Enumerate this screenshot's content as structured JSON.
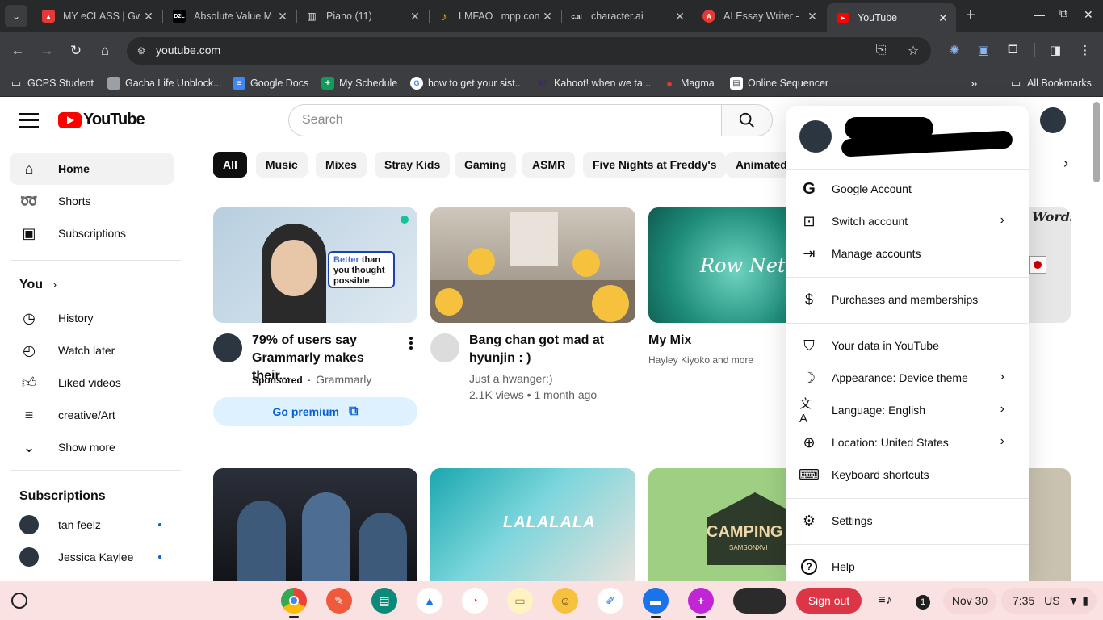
{
  "browser": {
    "tabs": [
      {
        "title": "MY eCLASS | Gwi",
        "icon": "eclass-icon",
        "color": "#e53935"
      },
      {
        "title": "Absolute Value M",
        "icon": "d2l-icon",
        "color": "#000000"
      },
      {
        "title": "Piano (11)",
        "icon": "piano-icon",
        "color": "#ffffff"
      },
      {
        "title": "LMFAO | mpp.con",
        "icon": "music-note-icon",
        "color": "#f4b400"
      },
      {
        "title": "character.ai",
        "icon": "character-ai-icon",
        "color": "#ffffff"
      },
      {
        "title": "AI Essay Writer -",
        "icon": "essay-writer-icon",
        "color": "#e53935"
      },
      {
        "title": "YouTube",
        "icon": "youtube-icon",
        "color": "#ff0000",
        "active": true
      }
    ],
    "url": "youtube.com",
    "bookmarks": [
      {
        "label": "GCPS Student",
        "icon": "folder-icon"
      },
      {
        "label": "Gacha Life Unblock...",
        "icon": "gacha-icon"
      },
      {
        "label": "Google Docs",
        "icon": "docs-icon"
      },
      {
        "label": "My Schedule",
        "icon": "sheets-icon"
      },
      {
        "label": "how to get your sist...",
        "icon": "google-icon"
      },
      {
        "label": "Kahoot! when we ta...",
        "icon": "kahoot-icon"
      },
      {
        "label": "Magma",
        "icon": "magma-icon"
      },
      {
        "label": "Online Sequencer",
        "icon": "sequencer-icon"
      }
    ],
    "all_bookmarks": "All Bookmarks",
    "tab_glyphs": {
      "d2l": "D2L",
      "cai": "c.ai",
      "kahoot": "K!"
    }
  },
  "youtube": {
    "logo_text": "YouTube",
    "search_placeholder": "Search",
    "sidebar": {
      "top": [
        {
          "label": "Home",
          "icon": "home-icon",
          "active": true
        },
        {
          "label": "Shorts",
          "icon": "shorts-icon"
        },
        {
          "label": "Subscriptions",
          "icon": "subscriptions-icon"
        }
      ],
      "you_heading": "You",
      "you": [
        {
          "label": "History",
          "icon": "history-icon"
        },
        {
          "label": "Watch later",
          "icon": "watch-later-icon"
        },
        {
          "label": "Liked videos",
          "icon": "like-icon"
        },
        {
          "label": "creative/Art",
          "icon": "playlist-icon"
        },
        {
          "label": "Show more",
          "icon": "chevron-down-icon"
        }
      ],
      "subscriptions_heading": "Subscriptions",
      "subscriptions": [
        {
          "name": "tan feelz"
        },
        {
          "name": "Jessica Kaylee"
        }
      ]
    },
    "chips": [
      "All",
      "Music",
      "Mixes",
      "Stray Kids",
      "Gaming",
      "ASMR",
      "Five Nights at Freddy's",
      "Animated"
    ],
    "videos": [
      {
        "title_line1": "79% of users say",
        "title_line2": "Grammarly makes their...",
        "sponsored": "Sponsored",
        "channel": "Grammarly",
        "cta": "Go premium",
        "thumb_text": [
          "Better",
          "than",
          "you thought",
          "possible"
        ]
      },
      {
        "title_line1": "Bang chan got mad at",
        "title_line2": "hyunjin : )",
        "channel": "Just a hwanger:)",
        "stats": "2.1K views • 1 month ago"
      },
      {
        "title_line1": "My Mix",
        "channel": "Hayley Kiyoko and more",
        "thumb_text": "Row Netwo"
      }
    ],
    "thumb_texts": {
      "row2_b": "LALALALA",
      "row2_c": "CAMPING",
      "row2_c_sub": "SAMSONXVI",
      "row1_d": "Words"
    }
  },
  "account_menu": {
    "groups": [
      [
        {
          "label": "Google Account",
          "icon": "google-icon"
        },
        {
          "label": "Switch account",
          "icon": "switch-account-icon",
          "chevron": true
        },
        {
          "label": "Manage accounts",
          "icon": "sign-in-icon"
        }
      ],
      [
        {
          "label": "Purchases and memberships",
          "icon": "dollar-icon"
        }
      ],
      [
        {
          "label": "Your data in YouTube",
          "icon": "shield-person-icon"
        },
        {
          "label": "Appearance: Device theme",
          "icon": "moon-icon",
          "chevron": true
        },
        {
          "label": "Language: English",
          "icon": "translate-icon",
          "chevron": true
        },
        {
          "label": "Location: United States",
          "icon": "globe-icon",
          "chevron": true
        },
        {
          "label": "Keyboard shortcuts",
          "icon": "keyboard-icon"
        }
      ],
      [
        {
          "label": "Settings",
          "icon": "gear-icon"
        }
      ],
      [
        {
          "label": "Help",
          "icon": "help-icon"
        }
      ]
    ]
  },
  "shelf": {
    "sign_out": "Sign out",
    "notification_count": "1",
    "date": "Nov 30",
    "time": "7:35",
    "locale": "US"
  }
}
